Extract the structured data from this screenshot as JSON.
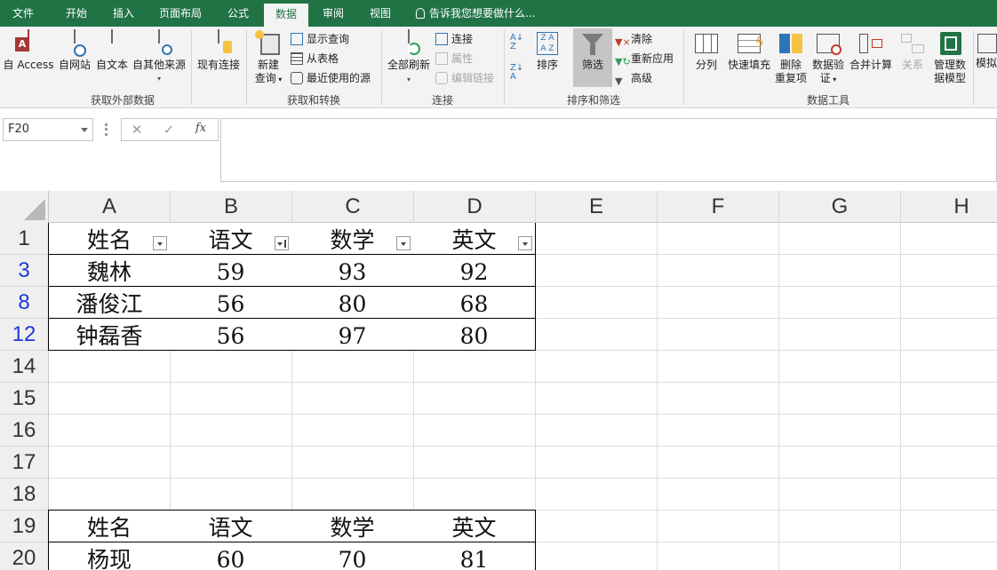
{
  "tabs": [
    "文件",
    "开始",
    "插入",
    "页面布局",
    "公式",
    "数据",
    "审阅",
    "视图"
  ],
  "active_tab": "数据",
  "tell_me": "告诉我您想要做什么...",
  "ribbon": {
    "get_external": {
      "label": "获取外部数据",
      "buttons": [
        "自 Access",
        "自网站",
        "自文本",
        "自其他来源",
        "现有连接"
      ]
    },
    "get_transform": {
      "label": "获取和转换",
      "new_query": "新建",
      "new_query2": "查询",
      "items": [
        "显示查询",
        "从表格",
        "最近使用的源"
      ]
    },
    "connections": {
      "label": "连接",
      "refresh": "全部刷新",
      "items": [
        "连接",
        "属性",
        "编辑链接"
      ]
    },
    "sort_filter": {
      "label": "排序和筛选",
      "sort": "排序",
      "filter": "筛选",
      "items": [
        "清除",
        "重新应用",
        "高级"
      ]
    },
    "data_tools": {
      "label": "数据工具",
      "split": "分列",
      "flash": "快速填充",
      "remove_dup": "删除",
      "remove_dup2": "重复项",
      "validate": "数据验",
      "validate2": "证",
      "consolidate": "合并计算",
      "relations": "关系",
      "model": "管理数",
      "model2": "据模型"
    },
    "forecast": {
      "whatif": "模拟"
    }
  },
  "formula_bar": {
    "name_box": "F20",
    "fx": "fx",
    "formula": ""
  },
  "columns": [
    "A",
    "B",
    "C",
    "D",
    "E",
    "F",
    "G",
    "H"
  ],
  "rows": [
    "1",
    "3",
    "8",
    "12",
    "14",
    "15",
    "16",
    "17",
    "18",
    "19",
    "20"
  ],
  "filtered_rows": [
    "3",
    "8",
    "12"
  ],
  "table1": {
    "header": [
      "姓名",
      "语文",
      "数学",
      "英文"
    ],
    "rows": [
      [
        "魏林",
        "59",
        "93",
        "92"
      ],
      [
        "潘俊江",
        "56",
        "80",
        "68"
      ],
      [
        "钟磊香",
        "56",
        "97",
        "80"
      ]
    ]
  },
  "table2": {
    "header": [
      "姓名",
      "语文",
      "数学",
      "英文"
    ],
    "rows": [
      [
        "杨现",
        "60",
        "70",
        "81"
      ]
    ]
  },
  "colors": {
    "excel_green": "#217346",
    "filtered_row_number": "#1f37d6"
  }
}
